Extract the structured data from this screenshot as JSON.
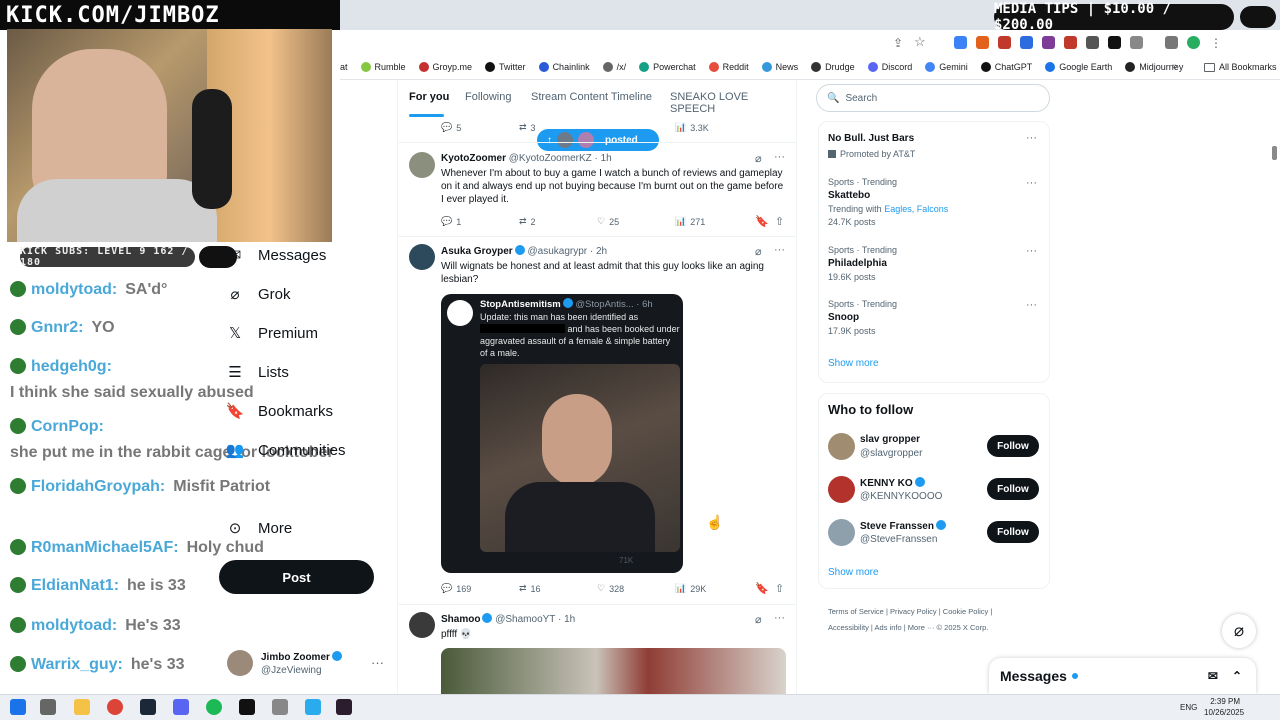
{
  "overlay": {
    "banner": "KICK.COM/JIMBOZ",
    "media_tips": "MEDIA TIPS | $10.00 / $200.00",
    "subs": "KICK SUBS: LEVEL 9 162 / 180"
  },
  "chat": [
    {
      "user": "moldytoad:",
      "msg": "SA'd°"
    },
    {
      "user": "Gnnr2:",
      "msg": "YO"
    },
    {
      "user": "hedgeh0g:",
      "msg": ""
    },
    {
      "user": "",
      "msg": "I think she said sexually abused"
    },
    {
      "user": "CornPop:",
      "msg": ""
    },
    {
      "user": "",
      "msg": "she put me in the rabbit cage for locktober"
    },
    {
      "user": "FloridahGroypah:",
      "msg": "Misfit Patriot"
    },
    {
      "user": "R0manMichael5AF:",
      "msg": "Holy chud"
    },
    {
      "user": "EldianNat1:",
      "msg": "he is 33"
    },
    {
      "user": "moldytoad:",
      "msg": "He's 33"
    },
    {
      "user": "Warrix_guy:",
      "msg": "he's 33"
    }
  ],
  "bookmarks": [
    "at",
    "Rumble",
    "Groyp.me",
    "Twitter",
    "Chainlink",
    "/x/",
    "Powerchat",
    "Reddit",
    "News",
    "Drudge",
    "Discord",
    "Gemini",
    "ChatGPT",
    "Google Earth",
    "Midjourney"
  ],
  "all_bookmarks": "All Bookmarks",
  "nav": {
    "messages": "Messages",
    "grok": "Grok",
    "premium": "Premium",
    "lists": "Lists",
    "bookmarks": "Bookmarks",
    "communities": "Communities",
    "more": "More",
    "post": "Post"
  },
  "account": {
    "name": "Jimbo Zoomer",
    "handle": "@JzeViewing"
  },
  "tabs": [
    "For you",
    "Following",
    "Stream Content Timeline",
    "SNEAKO LOVE SPEECH"
  ],
  "posted_pill": "posted",
  "top_stats": {
    "replies": "5",
    "reposts": "3",
    "views": "3.3K"
  },
  "tweets": [
    {
      "name": "KyotoZoomer",
      "handle": "@KyotoZoomerKZ · 1h",
      "text": "Whenever I'm about to buy a game I watch a bunch of reviews and gameplay on it and always end up not buying because I'm burnt out on the game before I ever played it.",
      "replies": "1",
      "reposts": "2",
      "likes": "25",
      "views": "271"
    },
    {
      "name": "Asuka Groyper",
      "handle": "@asukagrypr · 2h",
      "text": "Will wignats be honest and at least admit that this guy looks like an aging lesbian?",
      "replies": "169",
      "reposts": "16",
      "likes": "328",
      "views": "29K",
      "quote": {
        "name": "StopAntisemitism",
        "handle": "@StopAntis... · 6h",
        "text_a": "Update: this man has been identified as",
        "text_b": "and has been booked under aggravated assault of a female & simple battery of a male.",
        "views": "71K"
      }
    },
    {
      "name": "Shamoo",
      "handle": "@ShamooYT · 1h",
      "text": "pffff 💀"
    }
  ],
  "search": {
    "placeholder": "Search"
  },
  "ad": {
    "title": "No Bull. Just Bars",
    "promoted": "Promoted by AT&T"
  },
  "trends": [
    {
      "cat": "Sports · Trending",
      "name": "Skattebo",
      "extra": "Trending with",
      "links": "Eagles, Falcons",
      "posts": "24.7K posts"
    },
    {
      "cat": "Sports · Trending",
      "name": "Philadelphia",
      "posts": "19.6K posts"
    },
    {
      "cat": "Sports · Trending",
      "name": "Snoop",
      "posts": "17.9K posts"
    }
  ],
  "show_more": "Show more",
  "who_to_follow": "Who to follow",
  "follows": [
    {
      "name": "slav gropper",
      "handle": "@slavgropper"
    },
    {
      "name": "KENNY KO",
      "handle": "@KENNYKOOOO"
    },
    {
      "name": "Steve Franssen",
      "handle": "@SteveFranssen"
    }
  ],
  "follow_label": "Follow",
  "footer": [
    "Terms of Service",
    "Privacy Policy",
    "Cookie Policy",
    "Accessibility",
    "Ads info",
    "More ···",
    "© 2025 X Corp."
  ],
  "messages_dock": "Messages",
  "taskbar": {
    "lang": "ENG",
    "time": "2:39 PM",
    "date": "10/26/2025"
  }
}
